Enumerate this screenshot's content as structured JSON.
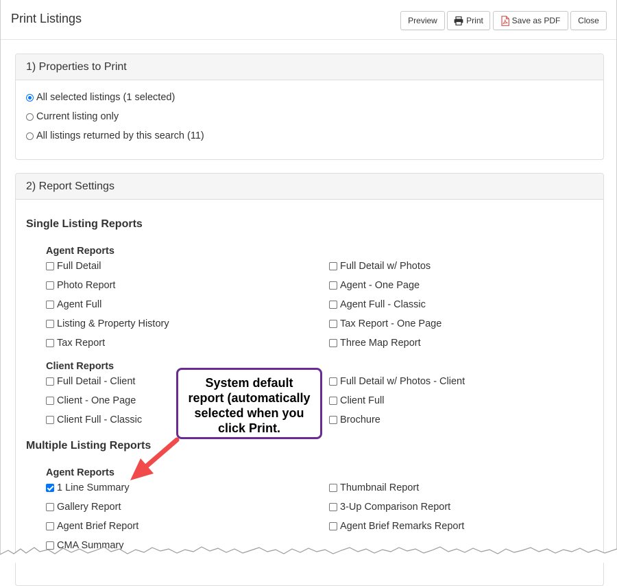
{
  "dialog": {
    "title": "Print Listings",
    "buttons": {
      "preview": "Preview",
      "print": "Print",
      "save_pdf": "Save as PDF",
      "close": "Close"
    }
  },
  "properties_section": {
    "heading": "1) Properties to Print",
    "options": [
      {
        "label": "All selected listings (1 selected)",
        "selected": true
      },
      {
        "label": "Current listing only",
        "selected": false
      },
      {
        "label": "All listings returned by this search (11)",
        "selected": false
      }
    ]
  },
  "report_section": {
    "heading": "2) Report Settings",
    "single": {
      "title": "Single Listing Reports",
      "agent": {
        "title": "Agent Reports",
        "left": [
          "Full Detail",
          "Photo Report",
          "Agent Full",
          "Listing & Property History",
          "Tax Report"
        ],
        "right": [
          "Full Detail w/ Photos",
          "Agent - One Page",
          "Agent Full - Classic",
          "Tax Report - One Page",
          "Three Map Report"
        ]
      },
      "client": {
        "title": "Client Reports",
        "left": [
          "Full Detail - Client",
          "Client - One Page",
          "Client Full - Classic"
        ],
        "right": [
          "Full Detail w/ Photos - Client",
          "Client Full",
          "Brochure"
        ]
      }
    },
    "multiple": {
      "title": "Multiple Listing Reports",
      "agent": {
        "title": "Agent Reports",
        "left": [
          "1 Line Summary",
          "Gallery Report",
          "Agent Brief Report",
          "CMA Summary"
        ],
        "right": [
          "Thumbnail Report",
          "3-Up Comparison Report",
          "Agent Brief Remarks Report"
        ],
        "checked": "1 Line Summary"
      }
    }
  },
  "callout": {
    "text_lines": [
      "System default",
      "report (automatically",
      "selected when you",
      "click Print."
    ],
    "border_color": "#6a2c91",
    "arrow_color": "#f04a4a"
  },
  "colors": {
    "accent": "#0075ff",
    "panel_heading_bg": "#f5f5f5",
    "pdf_icon": "#d9534f"
  }
}
